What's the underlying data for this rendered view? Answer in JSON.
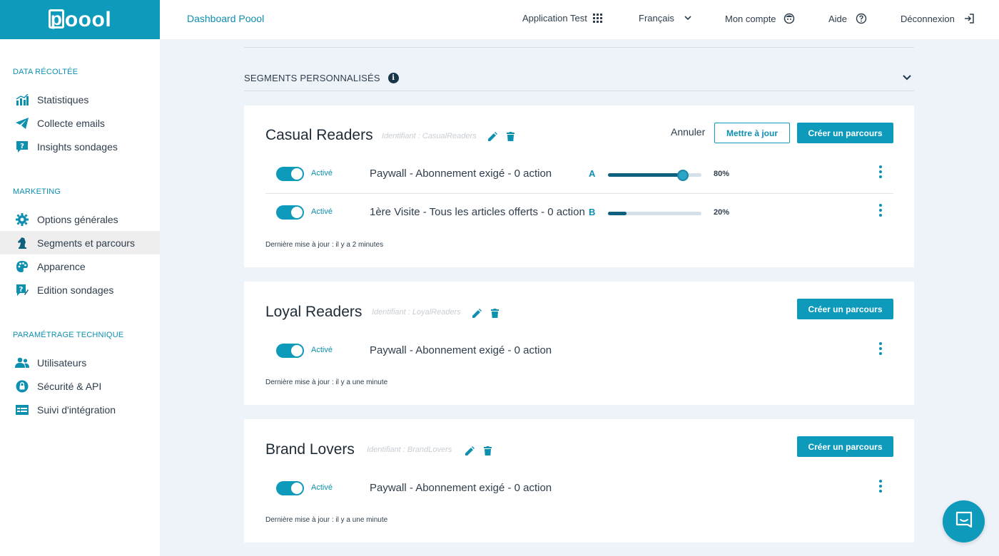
{
  "app": {
    "logo_text": "oool",
    "logo_p": "p",
    "title": "Dashboard Poool"
  },
  "topnav": {
    "app_switch": "Application Test",
    "language": "Français",
    "account": "Mon compte",
    "help": "Aide",
    "logout": "Déconnexion"
  },
  "sidebar": {
    "sections": [
      {
        "title": "DATA RÉCOLTÉE",
        "items": [
          {
            "label": "Statistiques",
            "icon": "bar-chart-icon"
          },
          {
            "label": "Collecte emails",
            "icon": "paper-plane-icon"
          },
          {
            "label": "Insights sondages",
            "icon": "question-bubble-icon"
          }
        ]
      },
      {
        "title": "MARKETING",
        "items": [
          {
            "label": "Options générales",
            "icon": "gear-icon"
          },
          {
            "label": "Segments et parcours",
            "icon": "chess-knight-icon",
            "active": true
          },
          {
            "label": "Apparence",
            "icon": "palette-icon"
          },
          {
            "label": "Edition sondages",
            "icon": "edit-question-icon"
          }
        ]
      },
      {
        "title": "PARAMÉTRAGE TECHNIQUE",
        "items": [
          {
            "label": "Utilisateurs",
            "icon": "users-icon"
          },
          {
            "label": "Sécurité & API",
            "icon": "lock-icon"
          },
          {
            "label": "Suivi d'intégration",
            "icon": "checklist-icon"
          }
        ]
      }
    ]
  },
  "segments_header": {
    "title": "SEGMENTS PERSONNALISÉS",
    "info": "i"
  },
  "cards": [
    {
      "title": "Casual Readers",
      "identifier": "Identifiant : CasualReaders",
      "cancel_label": "Annuler",
      "update_label": "Mettre à jour",
      "create_label": "Créer un parcours",
      "rows": [
        {
          "status": "Activé",
          "name": "Paywall - Abonnement exigé - 0 action",
          "letter": "A",
          "percent": "80%",
          "split": 0.8
        },
        {
          "status": "Activé",
          "name": "1ère Visite - Tous les articles offerts - 0 action",
          "letter": "B",
          "percent": "20%",
          "split": 0.2
        }
      ],
      "updated": "Dernière mise à jour : il y a 2 minutes"
    },
    {
      "title": "Loyal Readers",
      "identifier": "Identifiant : LoyalReaders",
      "create_label": "Créer un parcours",
      "rows": [
        {
          "status": "Activé",
          "name": "Paywall - Abonnement exigé - 0 action"
        }
      ],
      "updated": "Dernière mise à jour : il y a une minute"
    },
    {
      "title": "Brand Lovers",
      "identifier": "Identifiant : BrandLovers",
      "create_label": "Créer un parcours",
      "rows": [
        {
          "status": "Activé",
          "name": "Paywall - Abonnement exigé - 0 action"
        }
      ],
      "updated": "Dernière mise à jour : il y a une minute"
    }
  ],
  "colors": {
    "accent": "#0d9abb",
    "dark_accent": "#0f5f7f",
    "background": "#eef3f9"
  }
}
